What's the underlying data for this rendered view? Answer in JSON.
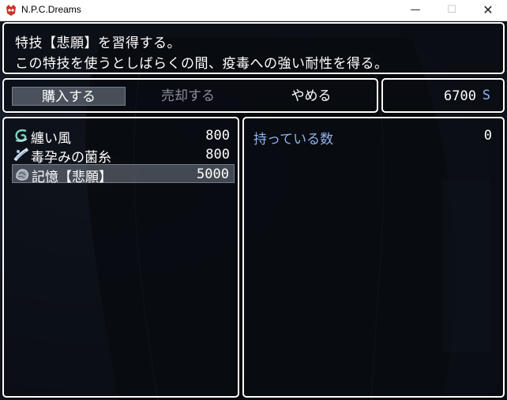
{
  "window": {
    "title": "N.P.C.Dreams",
    "minimize": "—",
    "maximize": "☐",
    "close": "✕"
  },
  "help": {
    "line1": "特技【悲願】を習得する。",
    "line2": "この特技を使うとしばらくの間、疫毒への強い耐性を得る。"
  },
  "commands": {
    "buy": "購入する",
    "sell": "売却する",
    "cancel": "やめる"
  },
  "gold": {
    "amount": "6700",
    "unit": "S"
  },
  "shop_items": [
    {
      "name": "纏い風",
      "price": "800",
      "icon": "wind-swirl-icon"
    },
    {
      "name": "毒孕みの菌糸",
      "price": "800",
      "icon": "mycelium-icon"
    },
    {
      "name": "記憶【悲願】",
      "price": "5000",
      "icon": "memory-icon",
      "selected": true
    }
  ],
  "status": {
    "label": "持っている数",
    "value": "0"
  },
  "colors": {
    "accent": "#8fb5ee",
    "disabled": "#8a8f98",
    "border": "#ffffff"
  }
}
